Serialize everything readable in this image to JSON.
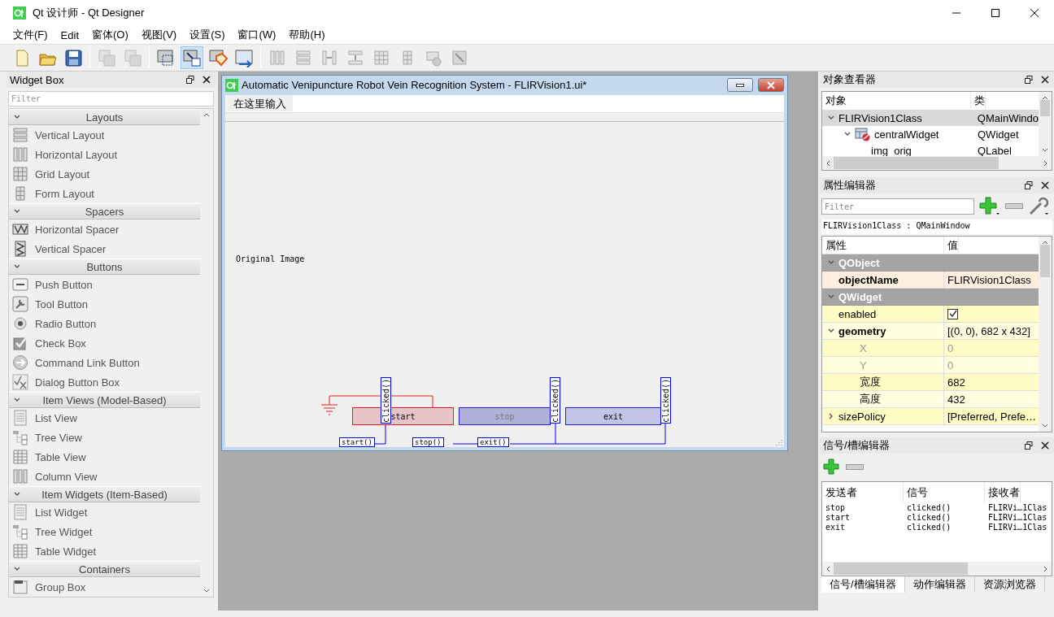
{
  "window": {
    "title": "Qt 设计师 - Qt Designer"
  },
  "menu": [
    "文件(F)",
    "Edit",
    "窗体(O)",
    "视图(V)",
    "设置(S)",
    "窗口(W)",
    "帮助(H)"
  ],
  "toolbar": [
    {
      "kind": "page",
      "selected": false,
      "disabled": false
    },
    {
      "kind": "folder",
      "selected": false,
      "disabled": false
    },
    {
      "kind": "floppy",
      "selected": false,
      "disabled": false
    },
    {
      "kind": "front",
      "selected": false,
      "disabled": true
    },
    {
      "kind": "back",
      "selected": false,
      "disabled": true
    },
    {
      "kind": "widget-edit",
      "selected": false,
      "disabled": false
    },
    {
      "kind": "signal-edit",
      "selected": true,
      "disabled": false
    },
    {
      "kind": "tag",
      "selected": false,
      "disabled": false
    },
    {
      "kind": "tab-order",
      "selected": false,
      "disabled": false
    },
    {
      "kind": "columns",
      "selected": false,
      "disabled": true
    },
    {
      "kind": "rows",
      "selected": false,
      "disabled": true
    },
    {
      "kind": "hsplit",
      "selected": false,
      "disabled": true
    },
    {
      "kind": "vsplit",
      "selected": false,
      "disabled": true
    },
    {
      "kind": "grid",
      "selected": false,
      "disabled": true
    },
    {
      "kind": "form",
      "selected": false,
      "disabled": true
    },
    {
      "kind": "break",
      "selected": false,
      "disabled": true
    },
    {
      "kind": "resize",
      "selected": false,
      "disabled": true
    }
  ],
  "widget_box": {
    "title": "Widget Box",
    "filter": {
      "placeholder": "Filter"
    },
    "sections": [
      {
        "title": "Layouts",
        "expanded": true,
        "items": [
          {
            "label": "Vertical Layout",
            "kind": "rows"
          },
          {
            "label": "Horizontal Layout",
            "kind": "columns"
          },
          {
            "label": "Grid Layout",
            "kind": "grid"
          },
          {
            "label": "Form Layout",
            "kind": "form"
          }
        ]
      },
      {
        "title": "Spacers",
        "expanded": true,
        "items": [
          {
            "label": "Horizontal Spacer",
            "kind": "hspring"
          },
          {
            "label": "Vertical Spacer",
            "kind": "vspring"
          }
        ]
      },
      {
        "title": "Buttons",
        "expanded": true,
        "items": [
          {
            "label": "Push Button",
            "kind": "push"
          },
          {
            "label": "Tool Button",
            "kind": "wrench"
          },
          {
            "label": "Radio Button",
            "kind": "radio"
          },
          {
            "label": "Check Box",
            "kind": "checkbox"
          },
          {
            "label": "Command Link Button",
            "kind": "arrow-circle"
          },
          {
            "label": "Dialog Button Box",
            "kind": "check-cross"
          }
        ]
      },
      {
        "title": "Item Views (Model-Based)",
        "expanded": true,
        "items": [
          {
            "label": "List View",
            "kind": "list"
          },
          {
            "label": "Tree View",
            "kind": "tree"
          },
          {
            "label": "Table View",
            "kind": "table"
          },
          {
            "label": "Column View",
            "kind": "columns"
          }
        ]
      },
      {
        "title": "Item Widgets (Item-Based)",
        "expanded": true,
        "items": [
          {
            "label": "List Widget",
            "kind": "list"
          },
          {
            "label": "Tree Widget",
            "kind": "tree"
          },
          {
            "label": "Table Widget",
            "kind": "table"
          }
        ]
      },
      {
        "title": "Containers",
        "expanded": true,
        "items": [
          {
            "label": "Group Box",
            "kind": "group"
          }
        ]
      }
    ]
  },
  "form": {
    "title": "Automatic Venipuncture Robot Vein Recognition System - FLIRVision1.ui*",
    "menu_placeholder": "在这里输入",
    "label": "Original Image",
    "buttons": [
      {
        "label": "start",
        "selected": true,
        "hovered": false,
        "signal": "clicked()",
        "slot": "start()"
      },
      {
        "label": "stop",
        "selected": false,
        "hovered": true,
        "signal": "clicked()",
        "slot": "stop()"
      },
      {
        "label": "exit",
        "selected": false,
        "hovered": false,
        "signal": "clicked()",
        "slot": "exit()"
      }
    ]
  },
  "object_inspector": {
    "title": "对象查看器",
    "columns": [
      "对象",
      "类"
    ],
    "tree": [
      {
        "name": "FLIRVision1Class",
        "class": "QMainWindo",
        "selected": true,
        "expanded": true,
        "children": [
          {
            "name": "centralWidget",
            "class": "QWidget",
            "selected": false,
            "expanded": true,
            "children": [
              {
                "name": "img_orig",
                "class": "QLabel",
                "selected": false
              }
            ]
          }
        ]
      }
    ]
  },
  "property_editor": {
    "title": "属性编辑器",
    "filter": {
      "placeholder": "Filter"
    },
    "object_class": "FLIRVision1Class : QMainWindow",
    "columns": [
      "属性",
      "值"
    ],
    "rows": [
      {
        "kind": "group",
        "name": "QObject",
        "expanded": true
      },
      {
        "kind": "prop",
        "name": "objectName",
        "value": "FLIRVision1Class",
        "modified": true
      },
      {
        "kind": "group",
        "name": "QWidget",
        "expanded": true
      },
      {
        "kind": "check",
        "name": "enabled",
        "checked": true,
        "modified": false
      },
      {
        "kind": "prop",
        "name": "geometry",
        "value": "[(0, 0), 682 x 432]",
        "modified": true,
        "expanded": true,
        "children": [
          {
            "name": "X",
            "value": "0",
            "disabled": true
          },
          {
            "name": "Y",
            "value": "0",
            "disabled": true
          },
          {
            "name": "宽度",
            "value": "682",
            "disabled": false
          },
          {
            "name": "高度",
            "value": "432",
            "disabled": false
          }
        ]
      },
      {
        "kind": "prop",
        "name": "sizePolicy",
        "value": "[Preferred, Prefe…",
        "modified": false,
        "expanded": false
      }
    ]
  },
  "signal_slot_editor": {
    "title": "信号/槽编辑器",
    "columns": [
      "发送者",
      "信号",
      "接收者"
    ],
    "rows": [
      {
        "sender": "stop",
        "signal": "clicked()",
        "receiver": "FLIRVi…1Clas"
      },
      {
        "sender": "start",
        "signal": "clicked()",
        "receiver": "FLIRVi…1Clas"
      },
      {
        "sender": "exit",
        "signal": "clicked()",
        "receiver": "FLIRVi…1Clas"
      }
    ],
    "tabs": [
      {
        "label": "信号/槽编辑器",
        "selected": true
      },
      {
        "label": "动作编辑器",
        "selected": false
      },
      {
        "label": "资源浏览器",
        "selected": false
      }
    ]
  }
}
